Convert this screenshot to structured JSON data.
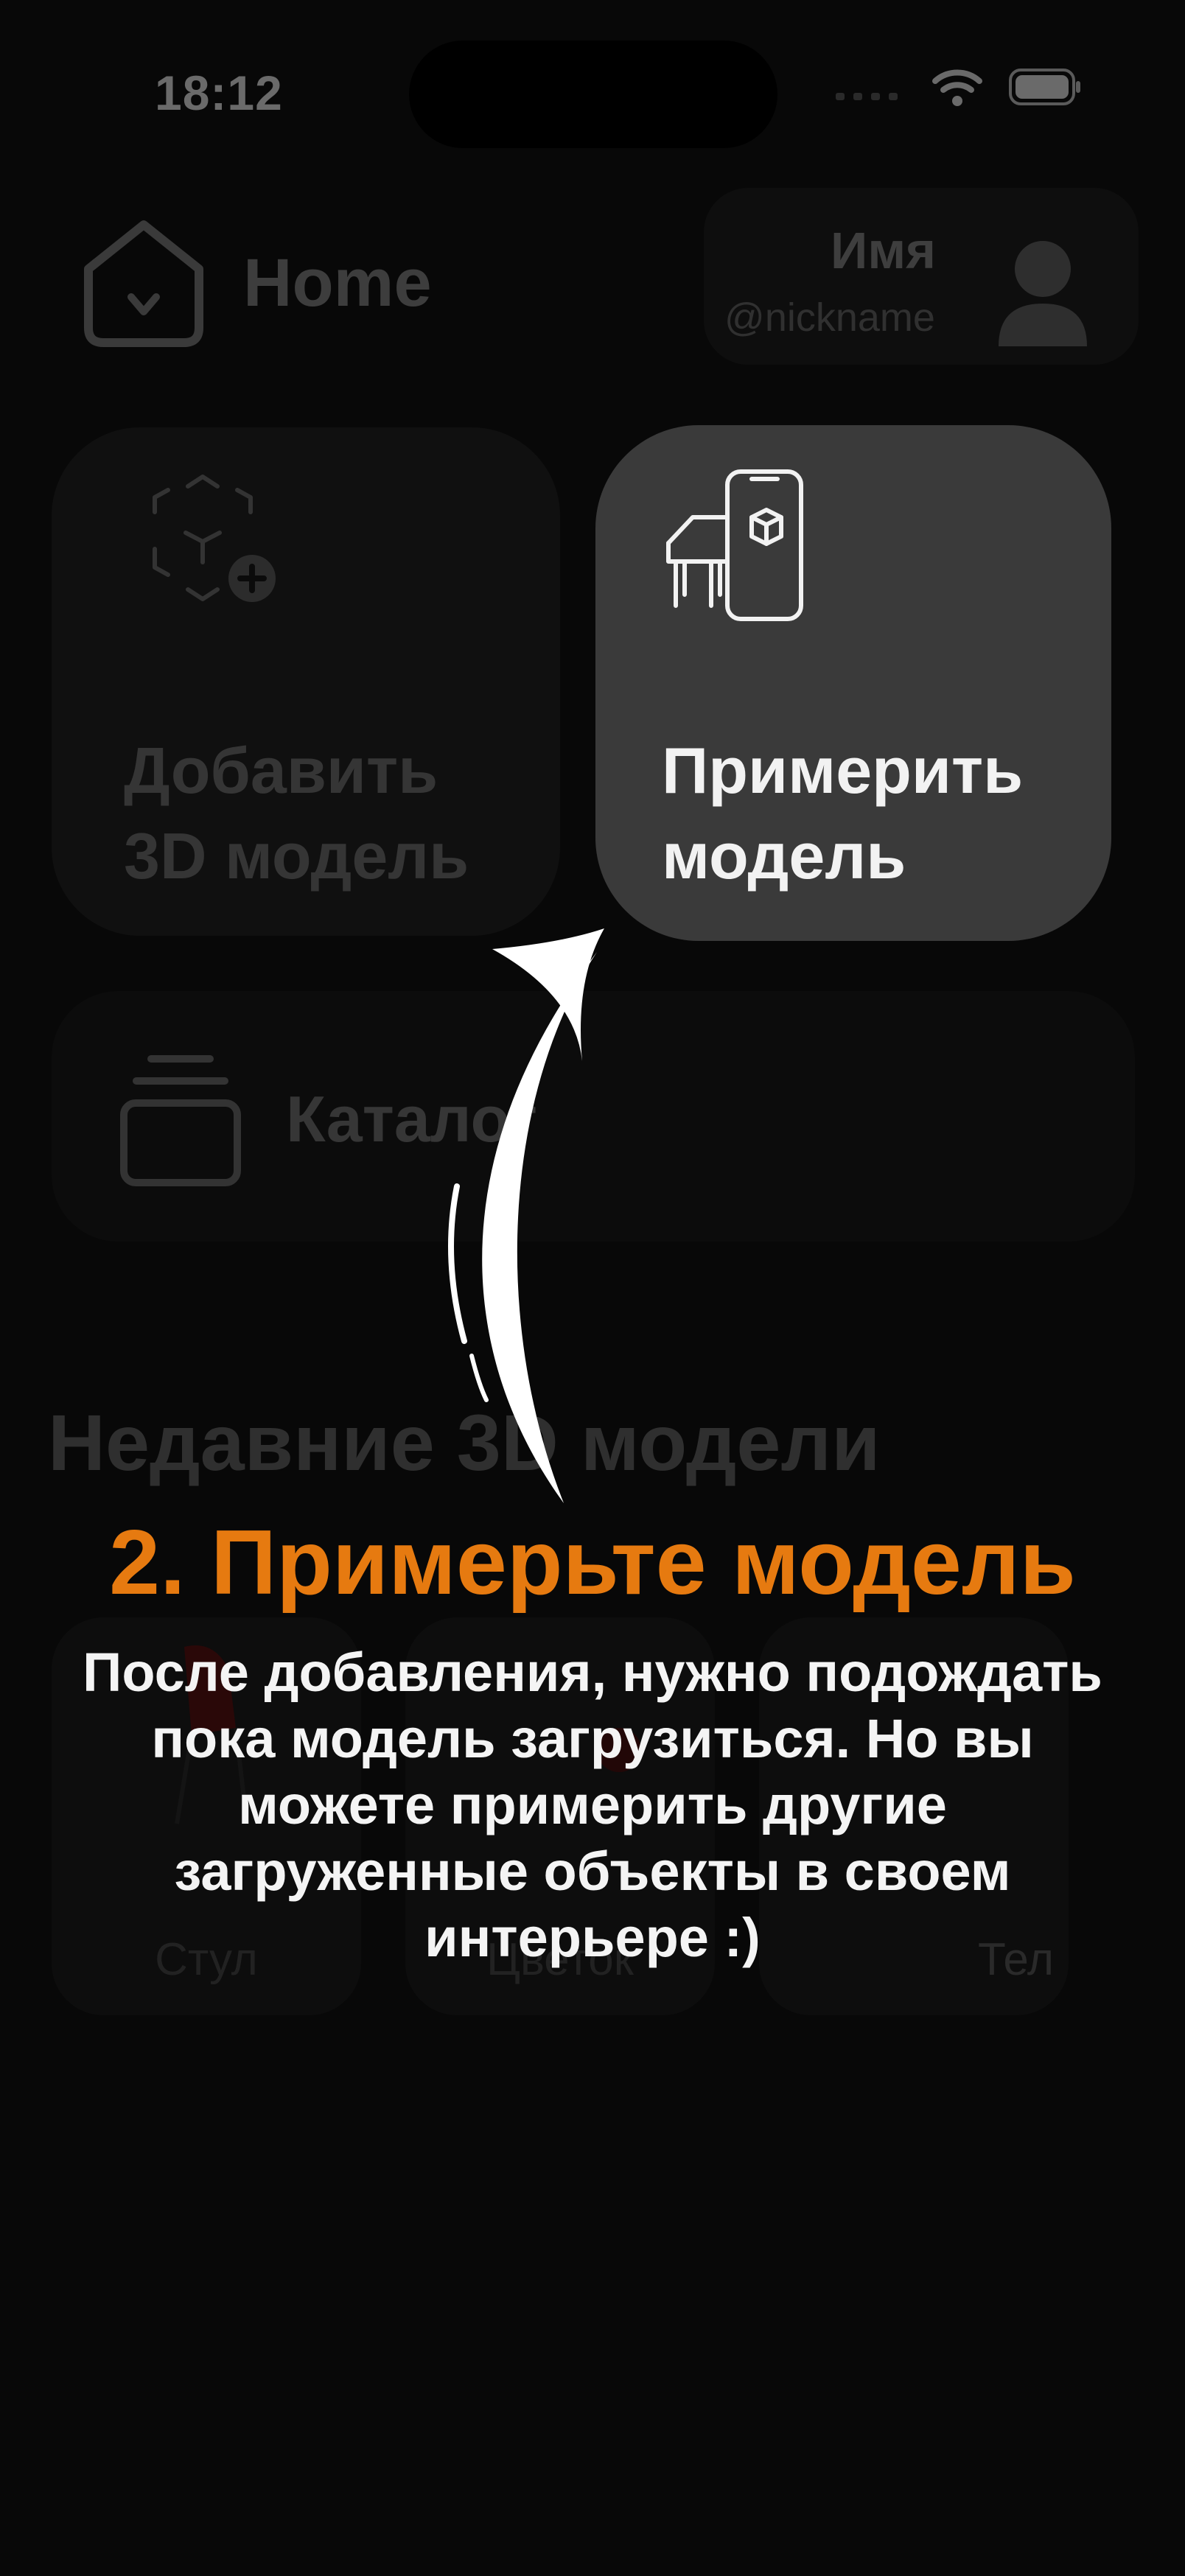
{
  "status_bar": {
    "time": "18:12"
  },
  "header": {
    "title": "Home"
  },
  "profile": {
    "name": "Имя",
    "nickname": "@nickname"
  },
  "actions": {
    "add_model": "Добавить\n3D модель",
    "try_model": "Примерить\nмодель",
    "catalog": "Каталог"
  },
  "recent": {
    "title": "Недавние 3D модели",
    "items": [
      "Стул",
      "Цветок",
      "Тел"
    ]
  },
  "tutorial": {
    "step_title": "2. Примерьте модель",
    "step_description": "После добавления, нужно подождать пока модель загрузиться. Но вы можете примерить другие загруженные объекты в своем интерьере :)",
    "accent_color": "#E67A10"
  }
}
